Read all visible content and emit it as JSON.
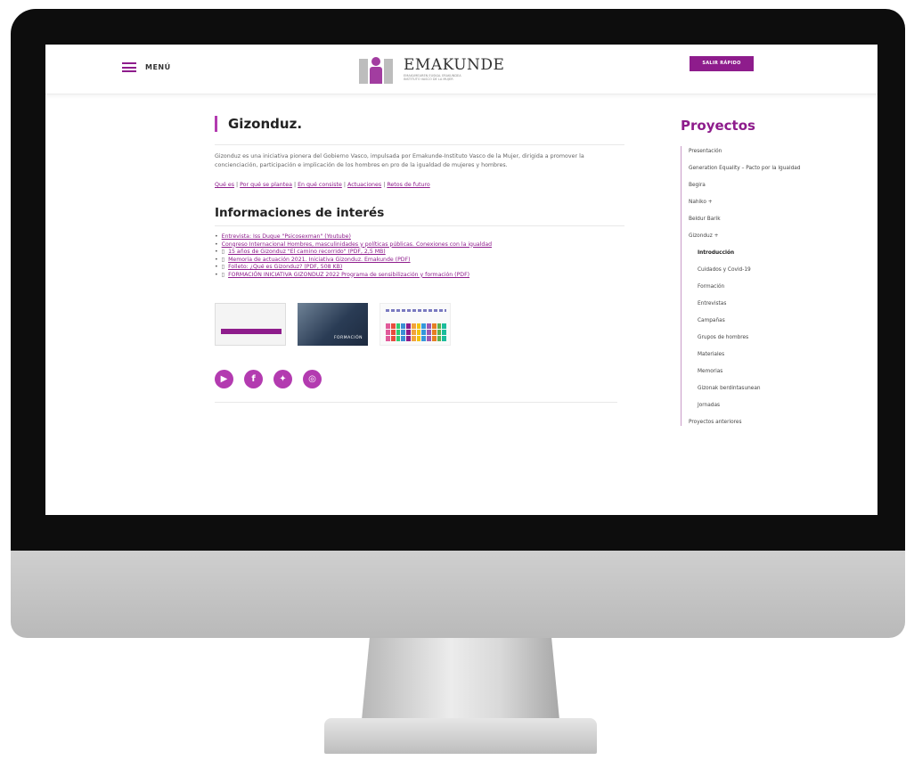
{
  "header": {
    "menu_label": "MENÚ",
    "logo_name": "EMAKUNDE",
    "logo_sub_1": "EMAKUMEAREN EUSKAL ERAKUNDEA",
    "logo_sub_2": "INSTITUTO VASCO DE LA MUJER",
    "exit_label": "SALIR RÁPIDO",
    "accent": "#8e1c8c"
  },
  "main": {
    "title": "Gizonduz.",
    "intro": "Gizonduz es una iniciativa pionera del Gobierno Vasco, impulsada por Emakunde-Instituto Vasco de la Mujer, dirigida a promover la concienciación, participación e implicación de los hombres en pro de la igualdad de mujeres y hombres.",
    "anchors": [
      "Qué es",
      "Por qué se plantea",
      "En qué consiste",
      "Actuaciones",
      "Retos de futuro"
    ],
    "section_title": "Informaciones de interés",
    "links": [
      "Entrevista: Iss Duque \"Psicosexman\" (Youtube)",
      "Congreso Internacional Hombres, masculinidades y políticas públicas. Conexiones con la igualdad",
      "15 años de Gizonduz \"El camino recorrido\" (PDF, 2,5 MB)",
      "Memoria de actuación 2021. Iniciativa Gizonduz. Emakunde (PDF)",
      "Folleto: ¿Qué es Gizonduz? (PDF, 508 KB)",
      "FORMACIÓN INICIATIVA GIZONDUZ 2022 Programa de sensibilización y formación (PDF)"
    ],
    "thumb_2_label": "FORMACIÓN",
    "social_icons": [
      "youtube-icon",
      "facebook-icon",
      "twitter-icon",
      "instagram-icon"
    ]
  },
  "sidebar": {
    "title": "Proyectos",
    "items": [
      {
        "label": "Presentación",
        "level": 0
      },
      {
        "label": "Generation Equality – Pacto por la Igualdad",
        "level": 0
      },
      {
        "label": "Begira",
        "level": 0
      },
      {
        "label": "Nahiko +",
        "level": 0
      },
      {
        "label": "Beldur Barik",
        "level": 0
      },
      {
        "label": "Gizonduz +",
        "level": 0
      },
      {
        "label": "Introducción",
        "level": 1,
        "active": true
      },
      {
        "label": "Cuidados y Covid-19",
        "level": 1
      },
      {
        "label": "Formación",
        "level": 1
      },
      {
        "label": "Entrevistas",
        "level": 1
      },
      {
        "label": "Campañas",
        "level": 1
      },
      {
        "label": "Grupos de hombres",
        "level": 1
      },
      {
        "label": "Materiales",
        "level": 1
      },
      {
        "label": "Memorias",
        "level": 1
      },
      {
        "label": "Gizonak berdintasunean",
        "level": 1
      },
      {
        "label": "Jornadas",
        "level": 1
      },
      {
        "label": "Proyectos anteriores",
        "level": 0
      }
    ]
  }
}
